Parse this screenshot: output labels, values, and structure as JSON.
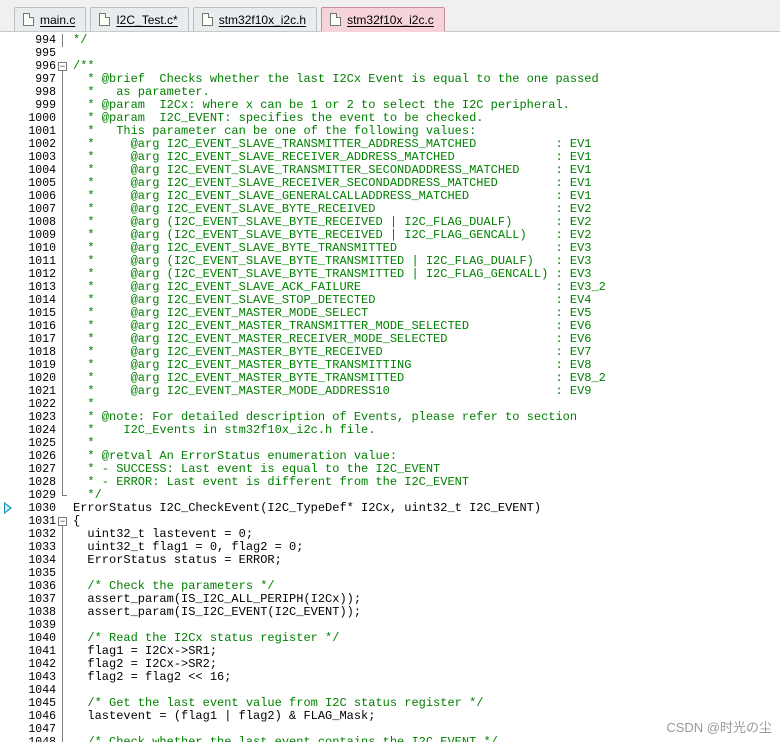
{
  "tabs": [
    {
      "label": "main.c",
      "active": false
    },
    {
      "label": "I2C_Test.c*",
      "active": false
    },
    {
      "label": "stm32f10x_i2c.h",
      "active": false
    },
    {
      "label": "stm32f10x_i2c.c",
      "active": true
    }
  ],
  "editor": {
    "lines": [
      {
        "n": "994",
        "text": "*/",
        "kind": "comment",
        "fold": "line"
      },
      {
        "n": "995",
        "text": "",
        "kind": "plain",
        "fold": "none"
      },
      {
        "n": "996",
        "text": "/**",
        "kind": "comment",
        "fold": "open"
      },
      {
        "n": "997",
        "text": "  * @brief  Checks whether the last I2Cx Event is equal to the one passed",
        "kind": "comment",
        "fold": "line"
      },
      {
        "n": "998",
        "text": "  *   as parameter.",
        "kind": "comment",
        "fold": "line"
      },
      {
        "n": "999",
        "text": "  * @param  I2Cx: where x can be 1 or 2 to select the I2C peripheral.",
        "kind": "comment",
        "fold": "line"
      },
      {
        "n": "1000",
        "text": "  * @param  I2C_EVENT: specifies the event to be checked.",
        "kind": "comment",
        "fold": "line"
      },
      {
        "n": "1001",
        "text": "  *   This parameter can be one of the following values:",
        "kind": "comment",
        "fold": "line"
      },
      {
        "n": "1002",
        "text": "  *     @arg I2C_EVENT_SLAVE_TRANSMITTER_ADDRESS_MATCHED           : EV1",
        "kind": "comment",
        "fold": "line"
      },
      {
        "n": "1003",
        "text": "  *     @arg I2C_EVENT_SLAVE_RECEIVER_ADDRESS_MATCHED              : EV1",
        "kind": "comment",
        "fold": "line"
      },
      {
        "n": "1004",
        "text": "  *     @arg I2C_EVENT_SLAVE_TRANSMITTER_SECONDADDRESS_MATCHED     : EV1",
        "kind": "comment",
        "fold": "line"
      },
      {
        "n": "1005",
        "text": "  *     @arg I2C_EVENT_SLAVE_RECEIVER_SECONDADDRESS_MATCHED        : EV1",
        "kind": "comment",
        "fold": "line"
      },
      {
        "n": "1006",
        "text": "  *     @arg I2C_EVENT_SLAVE_GENERALCALLADDRESS_MATCHED            : EV1",
        "kind": "comment",
        "fold": "line"
      },
      {
        "n": "1007",
        "text": "  *     @arg I2C_EVENT_SLAVE_BYTE_RECEIVED                         : EV2",
        "kind": "comment",
        "fold": "line"
      },
      {
        "n": "1008",
        "text": "  *     @arg (I2C_EVENT_SLAVE_BYTE_RECEIVED | I2C_FLAG_DUALF)      : EV2",
        "kind": "comment",
        "fold": "line"
      },
      {
        "n": "1009",
        "text": "  *     @arg (I2C_EVENT_SLAVE_BYTE_RECEIVED | I2C_FLAG_GENCALL)    : EV2",
        "kind": "comment",
        "fold": "line"
      },
      {
        "n": "1010",
        "text": "  *     @arg I2C_EVENT_SLAVE_BYTE_TRANSMITTED                      : EV3",
        "kind": "comment",
        "fold": "line"
      },
      {
        "n": "1011",
        "text": "  *     @arg (I2C_EVENT_SLAVE_BYTE_TRANSMITTED | I2C_FLAG_DUALF)   : EV3",
        "kind": "comment",
        "fold": "line"
      },
      {
        "n": "1012",
        "text": "  *     @arg (I2C_EVENT_SLAVE_BYTE_TRANSMITTED | I2C_FLAG_GENCALL) : EV3",
        "kind": "comment",
        "fold": "line"
      },
      {
        "n": "1013",
        "text": "  *     @arg I2C_EVENT_SLAVE_ACK_FAILURE                           : EV3_2",
        "kind": "comment",
        "fold": "line"
      },
      {
        "n": "1014",
        "text": "  *     @arg I2C_EVENT_SLAVE_STOP_DETECTED                         : EV4",
        "kind": "comment",
        "fold": "line"
      },
      {
        "n": "1015",
        "text": "  *     @arg I2C_EVENT_MASTER_MODE_SELECT                          : EV5",
        "kind": "comment",
        "fold": "line"
      },
      {
        "n": "1016",
        "text": "  *     @arg I2C_EVENT_MASTER_TRANSMITTER_MODE_SELECTED            : EV6",
        "kind": "comment",
        "fold": "line"
      },
      {
        "n": "1017",
        "text": "  *     @arg I2C_EVENT_MASTER_RECEIVER_MODE_SELECTED               : EV6",
        "kind": "comment",
        "fold": "line"
      },
      {
        "n": "1018",
        "text": "  *     @arg I2C_EVENT_MASTER_BYTE_RECEIVED                        : EV7",
        "kind": "comment",
        "fold": "line"
      },
      {
        "n": "1019",
        "text": "  *     @arg I2C_EVENT_MASTER_BYTE_TRANSMITTING                    : EV8",
        "kind": "comment",
        "fold": "line"
      },
      {
        "n": "1020",
        "text": "  *     @arg I2C_EVENT_MASTER_BYTE_TRANSMITTED                     : EV8_2",
        "kind": "comment",
        "fold": "line"
      },
      {
        "n": "1021",
        "text": "  *     @arg I2C_EVENT_MASTER_MODE_ADDRESS10                       : EV9",
        "kind": "comment",
        "fold": "line"
      },
      {
        "n": "1022",
        "text": "  *",
        "kind": "comment",
        "fold": "line"
      },
      {
        "n": "1023",
        "text": "  * @note: For detailed description of Events, please refer to section",
        "kind": "comment",
        "fold": "line"
      },
      {
        "n": "1024",
        "text": "  *    I2C_Events in stm32f10x_i2c.h file.",
        "kind": "comment",
        "fold": "line"
      },
      {
        "n": "1025",
        "text": "  *",
        "kind": "comment",
        "fold": "line"
      },
      {
        "n": "1026",
        "text": "  * @retval An ErrorStatus enumeration value:",
        "kind": "comment",
        "fold": "line"
      },
      {
        "n": "1027",
        "text": "  * - SUCCESS: Last event is equal to the I2C_EVENT",
        "kind": "comment",
        "fold": "line"
      },
      {
        "n": "1028",
        "text": "  * - ERROR: Last event is different from the I2C_EVENT",
        "kind": "comment",
        "fold": "line"
      },
      {
        "n": "1029",
        "text": "  */",
        "kind": "comment",
        "fold": "end"
      },
      {
        "n": "1030",
        "text": "ErrorStatus I2C_CheckEvent(I2C_TypeDef* I2Cx, uint32_t I2C_EVENT)",
        "kind": "plain",
        "fold": "none"
      },
      {
        "n": "1031",
        "text": "{",
        "kind": "plain",
        "fold": "open"
      },
      {
        "n": "1032",
        "text": "  uint32_t lastevent = 0;",
        "kind": "plain",
        "fold": "line"
      },
      {
        "n": "1033",
        "text": "  uint32_t flag1 = 0, flag2 = 0;",
        "kind": "plain",
        "fold": "line"
      },
      {
        "n": "1034",
        "text": "  ErrorStatus status = ERROR;",
        "kind": "plain",
        "fold": "line"
      },
      {
        "n": "1035",
        "text": "",
        "kind": "plain",
        "fold": "line"
      },
      {
        "n": "1036",
        "text": "  /* Check the parameters */",
        "kind": "comment",
        "fold": "line"
      },
      {
        "n": "1037",
        "text": "  assert_param(IS_I2C_ALL_PERIPH(I2Cx));",
        "kind": "plain",
        "fold": "line"
      },
      {
        "n": "1038",
        "text": "  assert_param(IS_I2C_EVENT(I2C_EVENT));",
        "kind": "plain",
        "fold": "line"
      },
      {
        "n": "1039",
        "text": "",
        "kind": "plain",
        "fold": "line"
      },
      {
        "n": "1040",
        "text": "  /* Read the I2Cx status register */",
        "kind": "comment",
        "fold": "line"
      },
      {
        "n": "1041",
        "text": "  flag1 = I2Cx->SR1;",
        "kind": "plain",
        "fold": "line"
      },
      {
        "n": "1042",
        "text": "  flag2 = I2Cx->SR2;",
        "kind": "plain",
        "fold": "line"
      },
      {
        "n": "1043",
        "text": "  flag2 = flag2 << 16;",
        "kind": "plain",
        "fold": "line"
      },
      {
        "n": "1044",
        "text": "",
        "kind": "plain",
        "fold": "line"
      },
      {
        "n": "1045",
        "text": "  /* Get the last event value from I2C status register */",
        "kind": "comment",
        "fold": "line"
      },
      {
        "n": "1046",
        "text": "  lastevent = (flag1 | flag2) & FLAG_Mask;",
        "kind": "plain",
        "fold": "line"
      },
      {
        "n": "1047",
        "text": "",
        "kind": "plain",
        "fold": "line"
      },
      {
        "n": "1048",
        "text": "  /* Check whether the last event contains the I2C_EVENT */",
        "kind": "comment",
        "fold": "line"
      }
    ]
  },
  "watermark": "CSDN @时光の尘",
  "colors": {
    "comment": "#008000",
    "code": "#000000",
    "active_tab": "#f6d2d9",
    "arrow": "#0e8fb0"
  }
}
